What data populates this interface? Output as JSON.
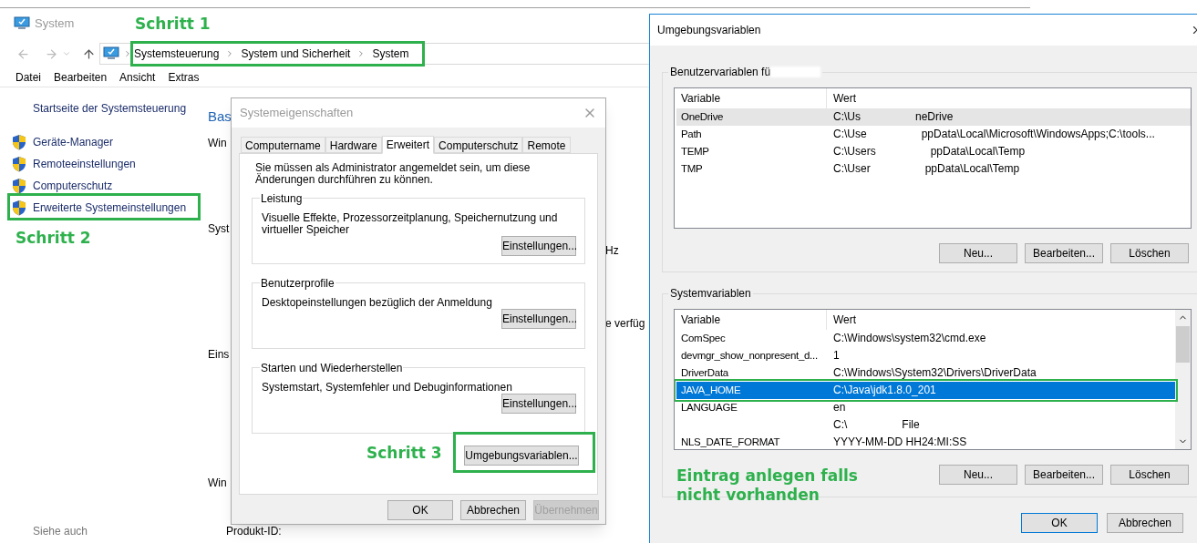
{
  "system_window": {
    "title": "System",
    "breadcrumb": [
      "Systemsteuerung",
      "System und Sicherheit",
      "System"
    ],
    "menu": [
      "Datei",
      "Bearbeiten",
      "Ansicht",
      "Extras"
    ],
    "sidebar": {
      "home": "Startseite der Systemsteuerung",
      "items": [
        "Geräte-Manager",
        "Remoteeinstellungen",
        "Computerschutz",
        "Erweiterte Systemeinstellungen"
      ],
      "see_also": "Siehe auch"
    },
    "content_left": [
      {
        "text": "Bas",
        "kind": "heading"
      },
      {
        "text": "Win",
        "kind": "section"
      },
      {
        "text": "Syst",
        "kind": "section"
      },
      {
        "text": "Eins",
        "kind": "section"
      },
      {
        "text": "Win",
        "kind": "section"
      },
      {
        "text": "Produkt-ID:",
        "kind": "item"
      }
    ],
    "content_right": [
      "Hz",
      "e verfüg"
    ]
  },
  "system_properties": {
    "title": "Systemeigenschaften",
    "tabs": [
      {
        "label": "Computername",
        "selected": false
      },
      {
        "label": "Hardware",
        "selected": false
      },
      {
        "label": "Erweitert",
        "selected": true
      },
      {
        "label": "Computerschutz",
        "selected": false
      },
      {
        "label": "Remote",
        "selected": false
      }
    ],
    "notice": "Sie müssen als Administrator angemeldet sein, um diese Änderungen durchführen zu können.",
    "groups": [
      {
        "legend": "Leistung",
        "description": "Visuelle Effekte, Prozessorzeitplanung, Speichernutzung und virtueller Speicher",
        "button": "Einstellungen..."
      },
      {
        "legend": "Benutzerprofile",
        "description": "Desktopeinstellungen bezüglich der Anmeldung",
        "button": "Einstellungen..."
      },
      {
        "legend": "Starten und Wiederherstellen",
        "description": "Systemstart, Systemfehler und Debuginformationen",
        "button": "Einstellungen..."
      }
    ],
    "env_button": "Umgebungsvariablen...",
    "buttons": [
      {
        "label": "OK",
        "disabled": false
      },
      {
        "label": "Abbrechen",
        "disabled": false
      },
      {
        "label": "Übernehmen",
        "disabled": true
      }
    ]
  },
  "environment_variables": {
    "title": "Umgebungsvariablen",
    "user_group": {
      "legend": "Benutzervariablen fü",
      "columns": [
        "Variable",
        "Wert"
      ],
      "rows": [
        {
          "variable": "OneDrive",
          "value": "C:\\Us",
          "value_end": "neDrive",
          "selected": false,
          "hovered": true
        },
        {
          "variable": "Path",
          "value": "C:\\Use",
          "value_end": "ppData\\Local\\Microsoft\\WindowsApps;C:\\tools...",
          "selected": false,
          "hovered": false
        },
        {
          "variable": "TEMP",
          "value": "C:\\Users",
          "value_end": "ppData\\Local\\Temp",
          "selected": false,
          "hovered": false
        },
        {
          "variable": "TMP",
          "value": "C:\\User",
          "value_end": "ppData\\Local\\Temp",
          "selected": false,
          "hovered": false
        }
      ],
      "buttons": [
        "Neu...",
        "Bearbeiten...",
        "Löschen"
      ]
    },
    "system_group": {
      "legend": "Systemvariablen",
      "columns": [
        "Variable",
        "Wert"
      ],
      "rows": [
        {
          "variable": "ComSpec",
          "value": "C:\\Windows\\system32\\cmd.exe",
          "selected": false
        },
        {
          "variable": "devmgr_show_nonpresent_d...",
          "value": "1",
          "selected": false
        },
        {
          "variable": "DriverData",
          "value": "C:\\Windows\\System32\\Drivers\\DriverData",
          "selected": false
        },
        {
          "variable": "JAVA_HOME",
          "value": "C:\\Java\\jdk1.8.0_201",
          "selected": true
        },
        {
          "variable": "LANGUAGE",
          "value": "en",
          "selected": false
        },
        {
          "value": "C:\\",
          "value_end": "File",
          "selected": false
        },
        {
          "variable": "NLS_DATE_FORMAT",
          "value": "YYYY-MM-DD HH24:MI:SS",
          "selected": false
        }
      ],
      "buttons": [
        "Neu...",
        "Bearbeiten...",
        "Löschen"
      ]
    },
    "buttons": [
      {
        "label": "OK",
        "default": true
      },
      {
        "label": "Abbrechen",
        "default": false
      }
    ]
  },
  "annotations": [
    "Schritt 1",
    "Schritt 2",
    "Schritt 3",
    "Eintrag anlegen falls nicht vorhanden"
  ]
}
